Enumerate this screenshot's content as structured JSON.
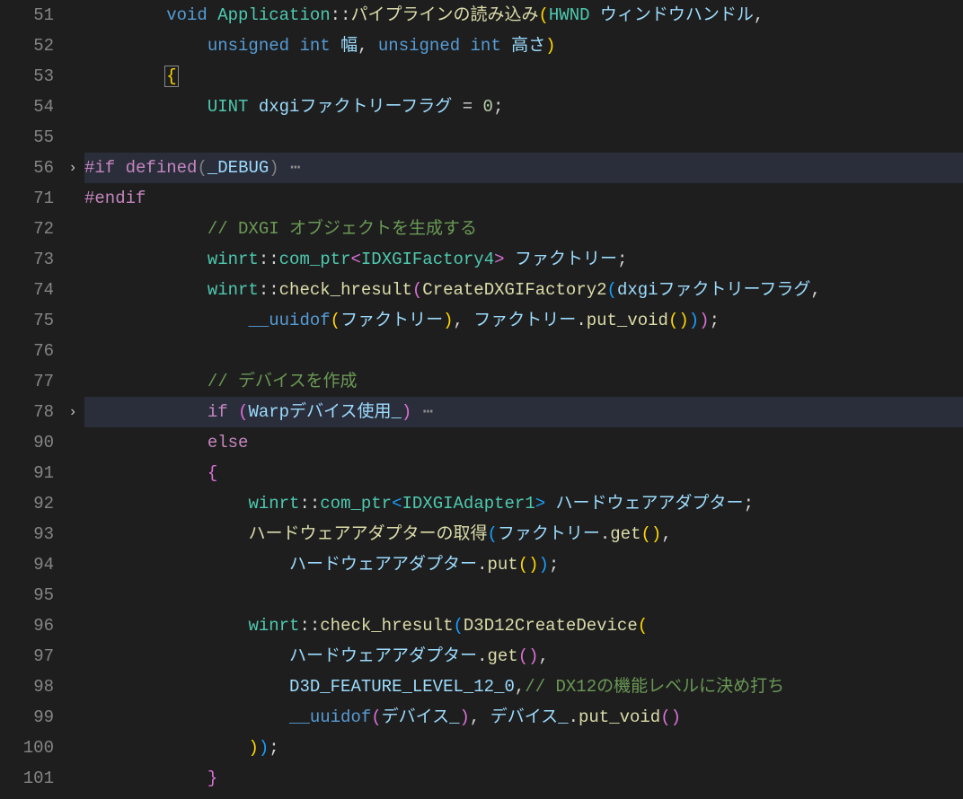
{
  "gutter": [
    "51",
    "52",
    "53",
    "54",
    "55",
    "56",
    "71",
    "72",
    "73",
    "74",
    "75",
    "76",
    "77",
    "78",
    "90",
    "91",
    "92",
    "93",
    "94",
    "95",
    "96",
    "97",
    "98",
    "99",
    "100",
    "101"
  ],
  "fold": [
    "",
    "",
    "",
    "",
    "",
    "›",
    "",
    "",
    "",
    "",
    "",
    "",
    "",
    "›",
    "",
    "",
    "",
    "",
    "",
    "",
    "",
    "",
    "",
    "",
    "",
    ""
  ],
  "rows": {
    "r0": [
      {
        "t": "        ",
        "c": "pun"
      },
      {
        "t": "void",
        "c": "kw"
      },
      {
        "t": " ",
        "c": "pun"
      },
      {
        "t": "Application",
        "c": "cls"
      },
      {
        "t": "::",
        "c": "pun"
      },
      {
        "t": "パイプラインの読み込み",
        "c": "fn"
      },
      {
        "t": "(",
        "c": "brc-y"
      },
      {
        "t": "HWND",
        "c": "type"
      },
      {
        "t": " ",
        "c": "pun"
      },
      {
        "t": "ウィンドウハンドル",
        "c": "ident"
      },
      {
        "t": ",",
        "c": "pun"
      }
    ],
    "r1": [
      {
        "t": "            ",
        "c": "pun"
      },
      {
        "t": "unsigned",
        "c": "kw"
      },
      {
        "t": " ",
        "c": "pun"
      },
      {
        "t": "int",
        "c": "kw"
      },
      {
        "t": " ",
        "c": "pun"
      },
      {
        "t": "幅",
        "c": "ident"
      },
      {
        "t": ", ",
        "c": "pun"
      },
      {
        "t": "unsigned",
        "c": "kw"
      },
      {
        "t": " ",
        "c": "pun"
      },
      {
        "t": "int",
        "c": "kw"
      },
      {
        "t": " ",
        "c": "pun"
      },
      {
        "t": "高さ",
        "c": "ident"
      },
      {
        "t": ")",
        "c": "brc-y"
      }
    ],
    "r2": [
      {
        "t": "        ",
        "c": "pun"
      },
      {
        "t": "{",
        "c": "brc-y cursorbrace"
      }
    ],
    "r3": [
      {
        "t": "            ",
        "c": "pun"
      },
      {
        "t": "UINT",
        "c": "type"
      },
      {
        "t": " ",
        "c": "pun"
      },
      {
        "t": "dxgiファクトリーフラグ",
        "c": "ident"
      },
      {
        "t": " = ",
        "c": "pun"
      },
      {
        "t": "0",
        "c": "num"
      },
      {
        "t": ";",
        "c": "pun"
      }
    ],
    "r4": [
      {
        "t": "",
        "c": "pun"
      }
    ],
    "r5": [
      {
        "t": "#if",
        "c": "kw2"
      },
      {
        "t": " ",
        "c": "pun"
      },
      {
        "t": "defined",
        "c": "kw2"
      },
      {
        "t": "(",
        "c": "grey"
      },
      {
        "t": "_DEBUG",
        "c": "ident"
      },
      {
        "t": ")",
        "c": "grey"
      },
      {
        "t": " ⋯",
        "c": "dots"
      }
    ],
    "r6": [
      {
        "t": "#endif",
        "c": "kw2"
      }
    ],
    "r7": [
      {
        "t": "            ",
        "c": "pun"
      },
      {
        "t": "// DXGI オブジェクトを生成する",
        "c": "cmt"
      }
    ],
    "r8": [
      {
        "t": "            ",
        "c": "pun"
      },
      {
        "t": "winrt",
        "c": "cls"
      },
      {
        "t": "::",
        "c": "pun"
      },
      {
        "t": "com_ptr",
        "c": "cls"
      },
      {
        "t": "<",
        "c": "brc-p"
      },
      {
        "t": "IDXGIFactory4",
        "c": "type"
      },
      {
        "t": ">",
        "c": "brc-p"
      },
      {
        "t": " ",
        "c": "pun"
      },
      {
        "t": "ファクトリー",
        "c": "ident"
      },
      {
        "t": ";",
        "c": "pun"
      }
    ],
    "r9": [
      {
        "t": "            ",
        "c": "pun"
      },
      {
        "t": "winrt",
        "c": "cls"
      },
      {
        "t": "::",
        "c": "pun"
      },
      {
        "t": "check_hresult",
        "c": "fn"
      },
      {
        "t": "(",
        "c": "brc-p"
      },
      {
        "t": "CreateDXGIFactory2",
        "c": "fn"
      },
      {
        "t": "(",
        "c": "brc-b"
      },
      {
        "t": "dxgiファクトリーフラグ",
        "c": "ident"
      },
      {
        "t": ",",
        "c": "pun"
      }
    ],
    "r10": [
      {
        "t": "                ",
        "c": "pun"
      },
      {
        "t": "__uuidof",
        "c": "mac"
      },
      {
        "t": "(",
        "c": "brc-y"
      },
      {
        "t": "ファクトリー",
        "c": "ident"
      },
      {
        "t": ")",
        "c": "brc-y"
      },
      {
        "t": ", ",
        "c": "pun"
      },
      {
        "t": "ファクトリー",
        "c": "ident"
      },
      {
        "t": ".",
        "c": "pun"
      },
      {
        "t": "put_void",
        "c": "fn"
      },
      {
        "t": "(",
        "c": "brc-y"
      },
      {
        "t": ")",
        "c": "brc-y"
      },
      {
        "t": ")",
        "c": "brc-b"
      },
      {
        "t": ")",
        "c": "brc-p"
      },
      {
        "t": ";",
        "c": "pun"
      }
    ],
    "r11": [
      {
        "t": "",
        "c": "pun"
      }
    ],
    "r12": [
      {
        "t": "            ",
        "c": "pun"
      },
      {
        "t": "// デバイスを作成",
        "c": "cmt"
      }
    ],
    "r13": [
      {
        "t": "            ",
        "c": "pun"
      },
      {
        "t": "if",
        "c": "kw2"
      },
      {
        "t": " ",
        "c": "pun"
      },
      {
        "t": "(",
        "c": "brc-p"
      },
      {
        "t": "Warpデバイス使用_",
        "c": "ident"
      },
      {
        "t": ")",
        "c": "brc-p"
      },
      {
        "t": " ⋯",
        "c": "dots"
      }
    ],
    "r14": [
      {
        "t": "            ",
        "c": "pun"
      },
      {
        "t": "else",
        "c": "kw2"
      }
    ],
    "r15": [
      {
        "t": "            ",
        "c": "pun"
      },
      {
        "t": "{",
        "c": "brc-p"
      }
    ],
    "r16": [
      {
        "t": "                ",
        "c": "pun"
      },
      {
        "t": "winrt",
        "c": "cls"
      },
      {
        "t": "::",
        "c": "pun"
      },
      {
        "t": "com_ptr",
        "c": "cls"
      },
      {
        "t": "<",
        "c": "brc-b"
      },
      {
        "t": "IDXGIAdapter1",
        "c": "type"
      },
      {
        "t": ">",
        "c": "brc-b"
      },
      {
        "t": " ",
        "c": "pun"
      },
      {
        "t": "ハードウェアアダプター",
        "c": "ident"
      },
      {
        "t": ";",
        "c": "pun"
      }
    ],
    "r17": [
      {
        "t": "                ",
        "c": "pun"
      },
      {
        "t": "ハードウェアアダプターの取得",
        "c": "fn"
      },
      {
        "t": "(",
        "c": "brc-b"
      },
      {
        "t": "ファクトリー",
        "c": "ident"
      },
      {
        "t": ".",
        "c": "pun"
      },
      {
        "t": "get",
        "c": "fn"
      },
      {
        "t": "(",
        "c": "brc-y"
      },
      {
        "t": ")",
        "c": "brc-y"
      },
      {
        "t": ",",
        "c": "pun"
      }
    ],
    "r18": [
      {
        "t": "                    ",
        "c": "pun"
      },
      {
        "t": "ハードウェアアダプター",
        "c": "ident"
      },
      {
        "t": ".",
        "c": "pun"
      },
      {
        "t": "put",
        "c": "fn"
      },
      {
        "t": "(",
        "c": "brc-y"
      },
      {
        "t": ")",
        "c": "brc-y"
      },
      {
        "t": ")",
        "c": "brc-b"
      },
      {
        "t": ";",
        "c": "pun"
      }
    ],
    "r19": [
      {
        "t": "",
        "c": "pun"
      }
    ],
    "r20": [
      {
        "t": "                ",
        "c": "pun"
      },
      {
        "t": "winrt",
        "c": "cls"
      },
      {
        "t": "::",
        "c": "pun"
      },
      {
        "t": "check_hresult",
        "c": "fn"
      },
      {
        "t": "(",
        "c": "brc-b"
      },
      {
        "t": "D3D12CreateDevice",
        "c": "fn"
      },
      {
        "t": "(",
        "c": "brc-y"
      }
    ],
    "r21": [
      {
        "t": "                    ",
        "c": "pun"
      },
      {
        "t": "ハードウェアアダプター",
        "c": "ident"
      },
      {
        "t": ".",
        "c": "pun"
      },
      {
        "t": "get",
        "c": "fn"
      },
      {
        "t": "(",
        "c": "brc-p"
      },
      {
        "t": ")",
        "c": "brc-p"
      },
      {
        "t": ",",
        "c": "pun"
      }
    ],
    "r22": [
      {
        "t": "                    ",
        "c": "pun"
      },
      {
        "t": "D3D_FEATURE_LEVEL_12_0",
        "c": "ident"
      },
      {
        "t": ",",
        "c": "pun"
      },
      {
        "t": "// DX12の機能レベルに決め打ち",
        "c": "cmt"
      }
    ],
    "r23": [
      {
        "t": "                    ",
        "c": "pun"
      },
      {
        "t": "__uuidof",
        "c": "mac"
      },
      {
        "t": "(",
        "c": "brc-p"
      },
      {
        "t": "デバイス_",
        "c": "ident"
      },
      {
        "t": ")",
        "c": "brc-p"
      },
      {
        "t": ", ",
        "c": "pun"
      },
      {
        "t": "デバイス_",
        "c": "ident"
      },
      {
        "t": ".",
        "c": "pun"
      },
      {
        "t": "put_void",
        "c": "fn"
      },
      {
        "t": "(",
        "c": "brc-p"
      },
      {
        "t": ")",
        "c": "brc-p"
      }
    ],
    "r24": [
      {
        "t": "                ",
        "c": "pun"
      },
      {
        "t": ")",
        "c": "brc-y"
      },
      {
        "t": ")",
        "c": "brc-b"
      },
      {
        "t": ";",
        "c": "pun"
      }
    ],
    "r25": [
      {
        "t": "            ",
        "c": "pun"
      },
      {
        "t": "}",
        "c": "brc-p"
      }
    ]
  },
  "highlight_rows": [
    5,
    13
  ]
}
